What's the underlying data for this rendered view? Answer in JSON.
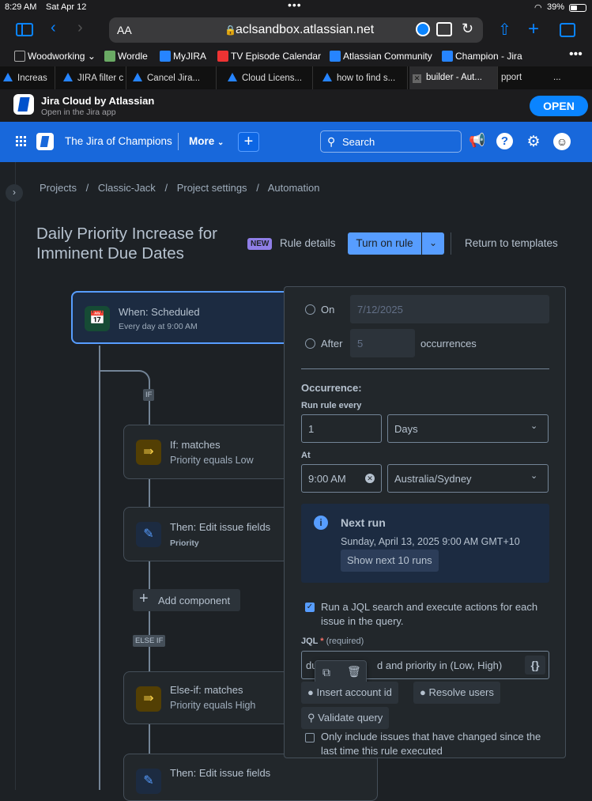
{
  "status": {
    "time": "8:29 AM",
    "date": "Sat Apr 12",
    "battery": "39%"
  },
  "safari": {
    "aa": "AA",
    "url": "aclsandbox.atlassian.net"
  },
  "bookmarks": [
    {
      "label": "Woodworking",
      "color": "#777"
    },
    {
      "label": "Wordle",
      "color": "#6aaa64"
    },
    {
      "label": "MyJIRA",
      "color": "#2684ff"
    },
    {
      "label": "TV Episode Calendar",
      "color": "#e33"
    },
    {
      "label": "Atlassian Community",
      "color": "#2684ff"
    },
    {
      "label": "Champion - Jira",
      "color": "#2684ff"
    }
  ],
  "tabs": [
    "Increas",
    "JIRA filter c",
    "Cancel Jira...",
    "Cloud Licens...",
    "how to find s...",
    "builder - Aut...",
    "pport",
    "..."
  ],
  "banner": {
    "title": "Jira Cloud by Atlassian",
    "subtitle": "Open in the Jira app",
    "open": "OPEN"
  },
  "header": {
    "site": "The Jira of Champions",
    "more": "More",
    "search": "Search"
  },
  "breadcrumbs": [
    "Projects",
    "/",
    "Classic-Jack",
    "/",
    "Project settings",
    "/",
    "Automation"
  ],
  "page": {
    "title": "Daily Priority Increase for Imminent Due Dates",
    "new_badge": "NEW",
    "rule_details": "Rule details",
    "turn_on": "Turn on rule",
    "return": "Return to templates"
  },
  "rule": {
    "trigger_title": "When: Scheduled",
    "trigger_sub": "Every day at 9:00 AM",
    "if_label": "IF",
    "if_title": "If: matches",
    "if_sub": "Priority equals Low",
    "then1_title": "Then: Edit issue fields",
    "then1_sub": "Priority",
    "add_component": "Add component",
    "elseif_label": "ELSE IF",
    "elseif_title": "Else-if: matches",
    "elseif_sub": "Priority equals High",
    "then2_title": "Then: Edit issue fields"
  },
  "panel": {
    "on_label": "On",
    "on_value": "7/12/2025",
    "after_label": "After",
    "after_value": "5",
    "occurrences": "occurrences",
    "occurrence": "Occurrence:",
    "run_every": "Run rule every",
    "every_value": "1",
    "unit": "Days",
    "at": "At",
    "time": "9:00 AM",
    "timezone": "Australia/Sydney",
    "next_run": "Next run",
    "next_run_value": "Sunday, April 13, 2025 9:00 AM GMT+10",
    "show_next": "Show next 10 runs",
    "jql_check": "Run a JQL search and execute actions for each issue in the query.",
    "jql_label": "JQL",
    "jql_required": "(required)",
    "jql_value_start": "du",
    "jql_value_end": "d and priority in (Low, High)",
    "insert_account": "Insert account id",
    "resolve_users": "Resolve users",
    "validate": "Validate query",
    "only_include": "Only include issues that have changed since the last time this rule executed"
  }
}
